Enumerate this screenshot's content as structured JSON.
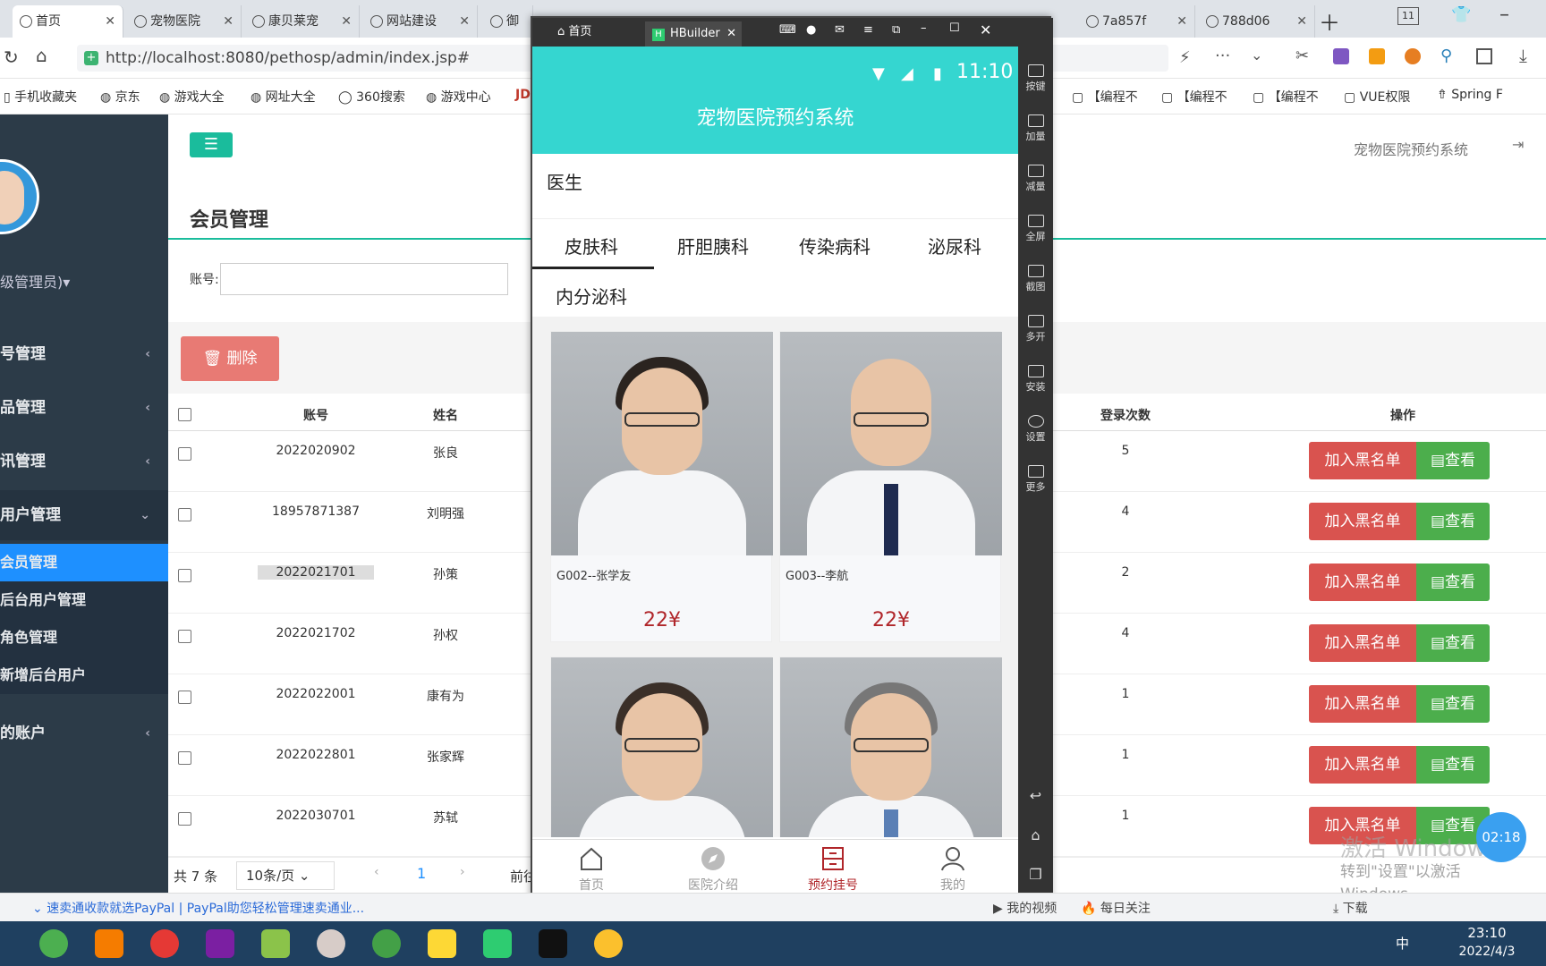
{
  "browser": {
    "tabs": [
      {
        "label": "首页",
        "active": true
      },
      {
        "label": "宠物医院"
      },
      {
        "label": "康贝莱宠"
      },
      {
        "label": "网站建设"
      },
      {
        "label": "御"
      },
      {
        "label": "7a857f"
      },
      {
        "label": "788d06"
      }
    ],
    "url": "http://localhost:8080/pethosp/admin/index.jsp#",
    "bookmarks": [
      "手机收藏夹",
      "京东",
      "游戏大全",
      "网址大全",
      "360搜索",
      "游戏中心",
      "JD",
      "【编程不",
      "【编程不",
      "【编程不",
      "VUE权限",
      "Spring F"
    ]
  },
  "admin": {
    "site_title": "宠物医院预约系统",
    "page_title": "会员管理",
    "search_label": "账号:",
    "delete_label": "删除",
    "user_role": "级管理员)▾",
    "nav": [
      "号管理",
      "品管理",
      "讯管理",
      "用户管理"
    ],
    "subnav": [
      "会员管理",
      "后台用户管理",
      "角色管理",
      "新增后台用户"
    ],
    "nav_last": "的账户",
    "columns": {
      "account": "账号",
      "name": "姓名",
      "logins": "登录次数",
      "ops": "操作"
    },
    "rows": [
      {
        "account": "2022020902",
        "name": "张良",
        "logins": "5"
      },
      {
        "account": "18957871387",
        "name": "刘明强",
        "logins": "4"
      },
      {
        "account": "2022021701",
        "name": "孙策",
        "logins": "2"
      },
      {
        "account": "2022021702",
        "name": "孙权",
        "logins": "4"
      },
      {
        "account": "2022022001",
        "name": "康有为",
        "logins": "1"
      },
      {
        "account": "2022022801",
        "name": "张家辉",
        "logins": "1"
      },
      {
        "account": "2022030701",
        "name": "苏轼",
        "logins": "1"
      }
    ],
    "blacklist_label": "加入黑名单",
    "view_label": "查看",
    "pager": {
      "total": "共 7 条",
      "per_page": "10条/页",
      "current": "1",
      "goto": "前往"
    },
    "watermark": [
      "激活 Windows",
      "转到\"设置\"以激活 Windows。"
    ],
    "timer": "02:18"
  },
  "emulator": {
    "tabs": [
      {
        "label": "首页"
      },
      {
        "label": "HBuilder"
      }
    ],
    "time": "11:10",
    "side_buttons": [
      "按键",
      "加量",
      "减量",
      "全屏",
      "截图",
      "多开",
      "安装",
      "设置",
      "更多"
    ]
  },
  "app": {
    "title": "宠物医院预约系统",
    "section": "医生",
    "departments": [
      "皮肤科",
      "肝胆胰科",
      "传染病科",
      "泌尿科",
      "内分泌科"
    ],
    "doctors": [
      {
        "name": "G002--张学友",
        "price": "22¥"
      },
      {
        "name": "G003--李航",
        "price": "22¥"
      },
      {
        "name": "",
        "price": ""
      },
      {
        "name": "",
        "price": ""
      }
    ],
    "bottom_nav": [
      "首页",
      "医院介绍",
      "预约挂号",
      "我的"
    ],
    "active_nav": 2
  },
  "status_strip": {
    "news": "速卖通收款就选PayPal | PayPal助您轻松管理速卖通业...",
    "items": [
      "我的视频",
      "每日关注",
      "下载"
    ]
  },
  "taskbar": {
    "time": "23:10",
    "date": "2022/4/3",
    "lang": "中"
  },
  "colors": {
    "sidebar": "#2c3b48",
    "teal": "#35d6d0",
    "danger": "#d9534f",
    "success": "#4cae4c",
    "price": "#b0262a",
    "accent": "#1abc9c"
  }
}
